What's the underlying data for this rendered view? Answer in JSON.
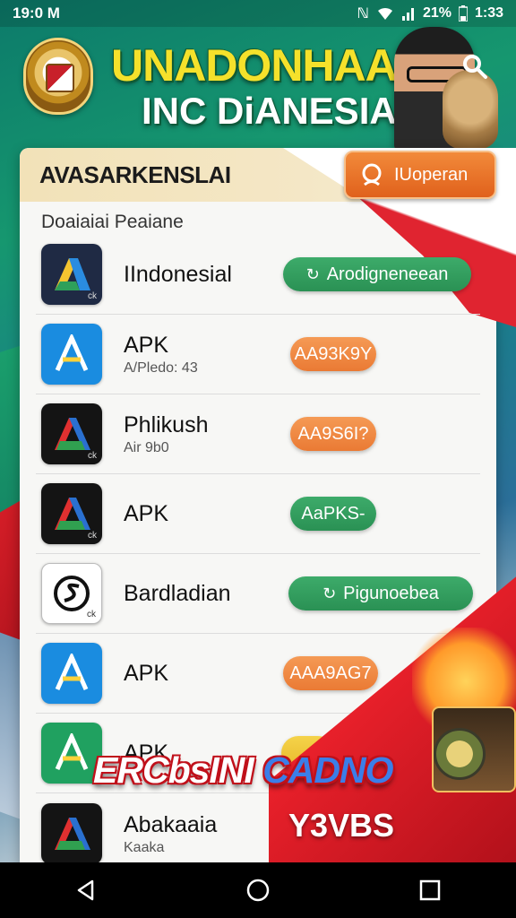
{
  "status_bar": {
    "time": "19:0 M",
    "battery": "21%",
    "clock": "1:33",
    "icons": [
      "nfc-icon",
      "wifi-icon",
      "signal-icon",
      "battery-icon"
    ]
  },
  "header": {
    "title_line1": "UNADONHAAH",
    "title_line2": "INC DiANESIA",
    "search_icon": "search-icon"
  },
  "card": {
    "title": "AVASARKENSLAI",
    "update_button": "IUoperan",
    "section_label": "Doaiaiai Peaiane"
  },
  "apps": [
    {
      "name": "IIndonesial",
      "sub": "",
      "action": "Arodigneneean",
      "action_style": "green",
      "action_icon": "refresh-icon",
      "icon_style": "navy",
      "icon_mark": "ck"
    },
    {
      "name": "APK",
      "sub": "A/Pledo: 43",
      "action": "AA93K9Y",
      "action_style": "orange",
      "action_icon": "",
      "icon_style": "sky",
      "icon_mark": ""
    },
    {
      "name": "Phlikush",
      "sub": "Air 9b0",
      "action": "AA9S6I?",
      "action_style": "orange",
      "action_icon": "",
      "icon_style": "dark",
      "icon_mark": "ck"
    },
    {
      "name": "APK",
      "sub": "",
      "action": "AaPKS-",
      "action_style": "green",
      "action_icon": "",
      "icon_style": "dark",
      "icon_mark": "ck"
    },
    {
      "name": "Bardladian",
      "sub": "",
      "action": "Pigunoebea",
      "action_style": "green",
      "action_icon": "refresh-icon",
      "icon_style": "white",
      "icon_mark": "ck"
    },
    {
      "name": "APK",
      "sub": "",
      "action": "AAA9AG7",
      "action_style": "orange",
      "action_icon": "",
      "icon_style": "sky",
      "icon_mark": ""
    },
    {
      "name": "APK",
      "sub": "",
      "action": "",
      "action_style": "yellow",
      "action_icon": "",
      "icon_style": "green",
      "icon_mark": ""
    },
    {
      "name": "Abakaaia",
      "sub": "Kaaka",
      "action": "",
      "action_style": "",
      "action_icon": "",
      "icon_style": "dark",
      "icon_mark": ""
    }
  ],
  "promo": {
    "title_part1": "ERCbsINI ",
    "title_part2": "CADNO",
    "subtitle": "Y3VBS"
  },
  "nav": {
    "back": "back-icon",
    "home": "home-icon",
    "recents": "recents-icon"
  },
  "colors": {
    "green_pill": "#2e9a5a",
    "orange_pill": "#ee8040",
    "update_button": "#e8702a",
    "flag_red": "#e02430"
  }
}
